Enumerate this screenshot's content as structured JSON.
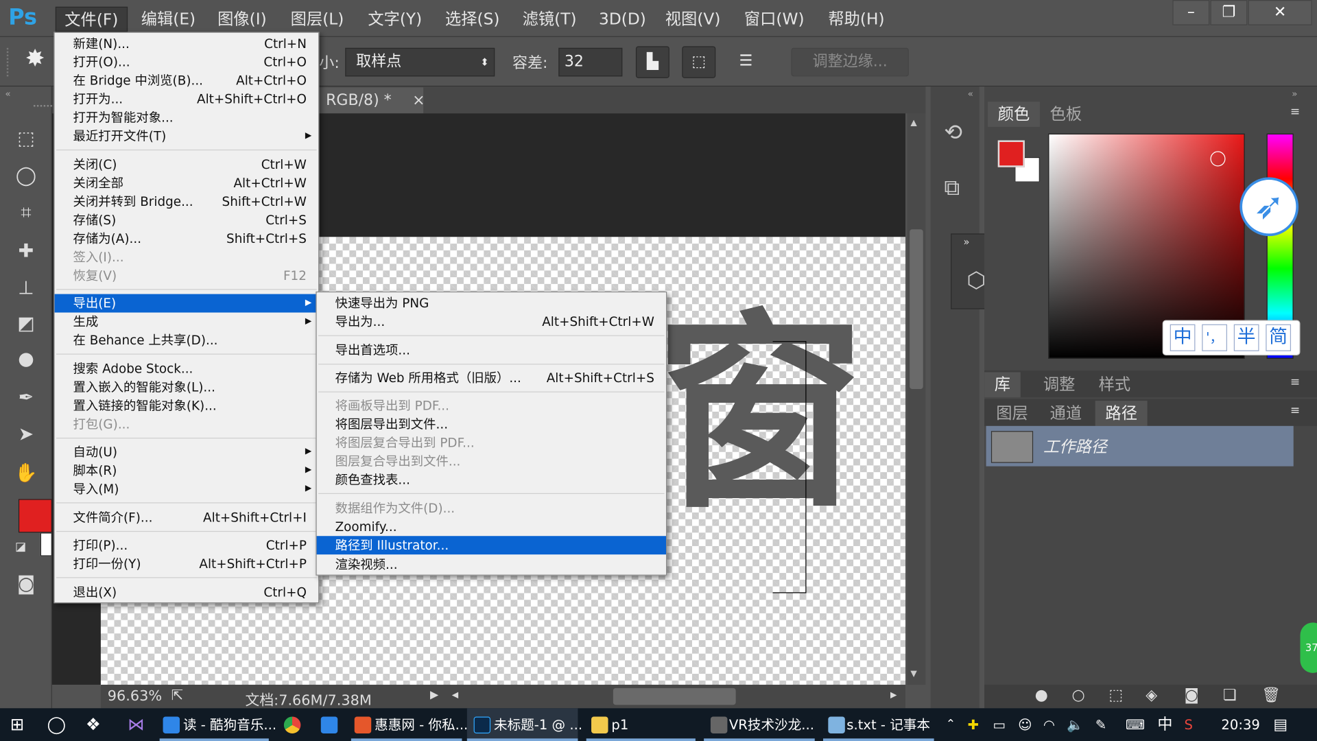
{
  "app": {
    "logo": "Ps"
  },
  "menubar": {
    "items": [
      "文件(F)",
      "编辑(E)",
      "图像(I)",
      "图层(L)",
      "文字(Y)",
      "选择(S)",
      "滤镜(T)",
      "3D(D)",
      "视图(V)",
      "窗口(W)",
      "帮助(H)"
    ],
    "window_buttons": [
      "–",
      "❐",
      "✕"
    ]
  },
  "options": {
    "size_label": "小:",
    "sample_value": "取样点",
    "tolerance_label": "容差:",
    "tolerance_value": "32",
    "refine_edge": "调整边缘..."
  },
  "document": {
    "tab_title": "RGB/8) *",
    "tab_close": "×",
    "glyph": "窗"
  },
  "status": {
    "zoom": "96.63%",
    "doc_size": "文档:7.66M/7.38M"
  },
  "file_menu": [
    {
      "label": "新建(N)...",
      "shortcut": "Ctrl+N"
    },
    {
      "label": "打开(O)...",
      "shortcut": "Ctrl+O"
    },
    {
      "label": "在 Bridge 中浏览(B)...",
      "shortcut": "Alt+Ctrl+O"
    },
    {
      "label": "打开为...",
      "shortcut": "Alt+Shift+Ctrl+O"
    },
    {
      "label": "打开为智能对象...",
      "shortcut": ""
    },
    {
      "label": "最近打开文件(T)",
      "shortcut": "",
      "submenu": true
    },
    {
      "label": "关闭(C)",
      "shortcut": "Ctrl+W"
    },
    {
      "label": "关闭全部",
      "shortcut": "Alt+Ctrl+W"
    },
    {
      "label": "关闭并转到 Bridge...",
      "shortcut": "Shift+Ctrl+W"
    },
    {
      "label": "存储(S)",
      "shortcut": "Ctrl+S"
    },
    {
      "label": "存储为(A)...",
      "shortcut": "Shift+Ctrl+S"
    },
    {
      "label": "签入(I)...",
      "shortcut": "",
      "disabled": true
    },
    {
      "label": "恢复(V)",
      "shortcut": "F12",
      "disabled": true
    },
    {
      "label": "导出(E)",
      "shortcut": "",
      "submenu": true,
      "selected": true
    },
    {
      "label": "生成",
      "shortcut": "",
      "submenu": true
    },
    {
      "label": "在 Behance 上共享(D)...",
      "shortcut": ""
    },
    {
      "label": "搜索 Adobe Stock...",
      "shortcut": ""
    },
    {
      "label": "置入嵌入的智能对象(L)...",
      "shortcut": ""
    },
    {
      "label": "置入链接的智能对象(K)...",
      "shortcut": ""
    },
    {
      "label": "打包(G)...",
      "shortcut": "",
      "disabled": true
    },
    {
      "label": "自动(U)",
      "shortcut": "",
      "submenu": true
    },
    {
      "label": "脚本(R)",
      "shortcut": "",
      "submenu": true
    },
    {
      "label": "导入(M)",
      "shortcut": "",
      "submenu": true
    },
    {
      "label": "文件简介(F)...",
      "shortcut": "Alt+Shift+Ctrl+I"
    },
    {
      "label": "打印(P)...",
      "shortcut": "Ctrl+P"
    },
    {
      "label": "打印一份(Y)",
      "shortcut": "Alt+Shift+Ctrl+P"
    },
    {
      "label": "退出(X)",
      "shortcut": "Ctrl+Q"
    }
  ],
  "export_menu": [
    {
      "label": "快速导出为 PNG",
      "shortcut": ""
    },
    {
      "label": "导出为...",
      "shortcut": "Alt+Shift+Ctrl+W"
    },
    {
      "label": "导出首选项...",
      "shortcut": ""
    },
    {
      "label": "存储为 Web 所用格式（旧版）...",
      "shortcut": "Alt+Shift+Ctrl+S"
    },
    {
      "label": "将画板导出到 PDF...",
      "shortcut": "",
      "disabled": true
    },
    {
      "label": "将图层导出到文件...",
      "shortcut": ""
    },
    {
      "label": "将图层复合导出到 PDF...",
      "shortcut": "",
      "disabled": true
    },
    {
      "label": "图层复合导出到文件...",
      "shortcut": "",
      "disabled": true
    },
    {
      "label": "颜色查找表...",
      "shortcut": ""
    },
    {
      "label": "数据组作为文件(D)...",
      "shortcut": "",
      "disabled": true
    },
    {
      "label": "Zoomify...",
      "shortcut": ""
    },
    {
      "label": "路径到 Illustrator...",
      "shortcut": "",
      "selected": true
    },
    {
      "label": "渲染视频...",
      "shortcut": ""
    }
  ],
  "panels": {
    "color_tabs": [
      "颜色",
      "色板"
    ],
    "adjust_tabs": [
      "库",
      "调整",
      "样式"
    ],
    "layer_tabs": [
      "图层",
      "通道",
      "路径"
    ],
    "path_item": "工作路径",
    "ime": [
      "中",
      "'，",
      "半",
      "简"
    ],
    "badge": "37"
  },
  "colors": {
    "foreground": "#e02020",
    "background": "#ffffff",
    "selection": "#0a64d2"
  },
  "taskbar": {
    "items": [
      "读 - 酷狗音乐...",
      "惠惠网 - 你私...",
      "未标题-1 @ ...",
      "p1",
      "VR技术沙龙...",
      "s.txt - 记事本"
    ],
    "ime": "中",
    "clock": "20:39"
  }
}
